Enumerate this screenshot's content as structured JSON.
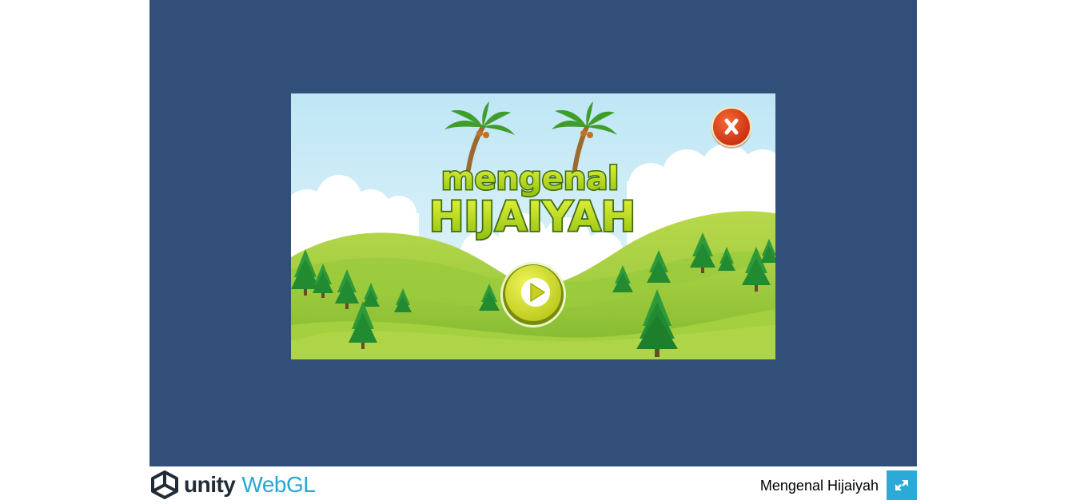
{
  "footer": {
    "logo_unity": "unity",
    "logo_webgl": "WebGL",
    "build_title": "Mengenal Hijaiyah",
    "fullscreen_icon": "expand-arrows-icon"
  },
  "game": {
    "title_line1": "mengenal",
    "title_line2": "HIJAIYAH",
    "close_icon": "close-x-icon",
    "play_icon": "play-icon"
  },
  "colors": {
    "canvas_bg": "#324f79",
    "unity_accent": "#23a8d6",
    "fullscreen_bg": "#2ba9d8",
    "title_yellow": "#c6e01a",
    "close_red": "#e1401a"
  }
}
